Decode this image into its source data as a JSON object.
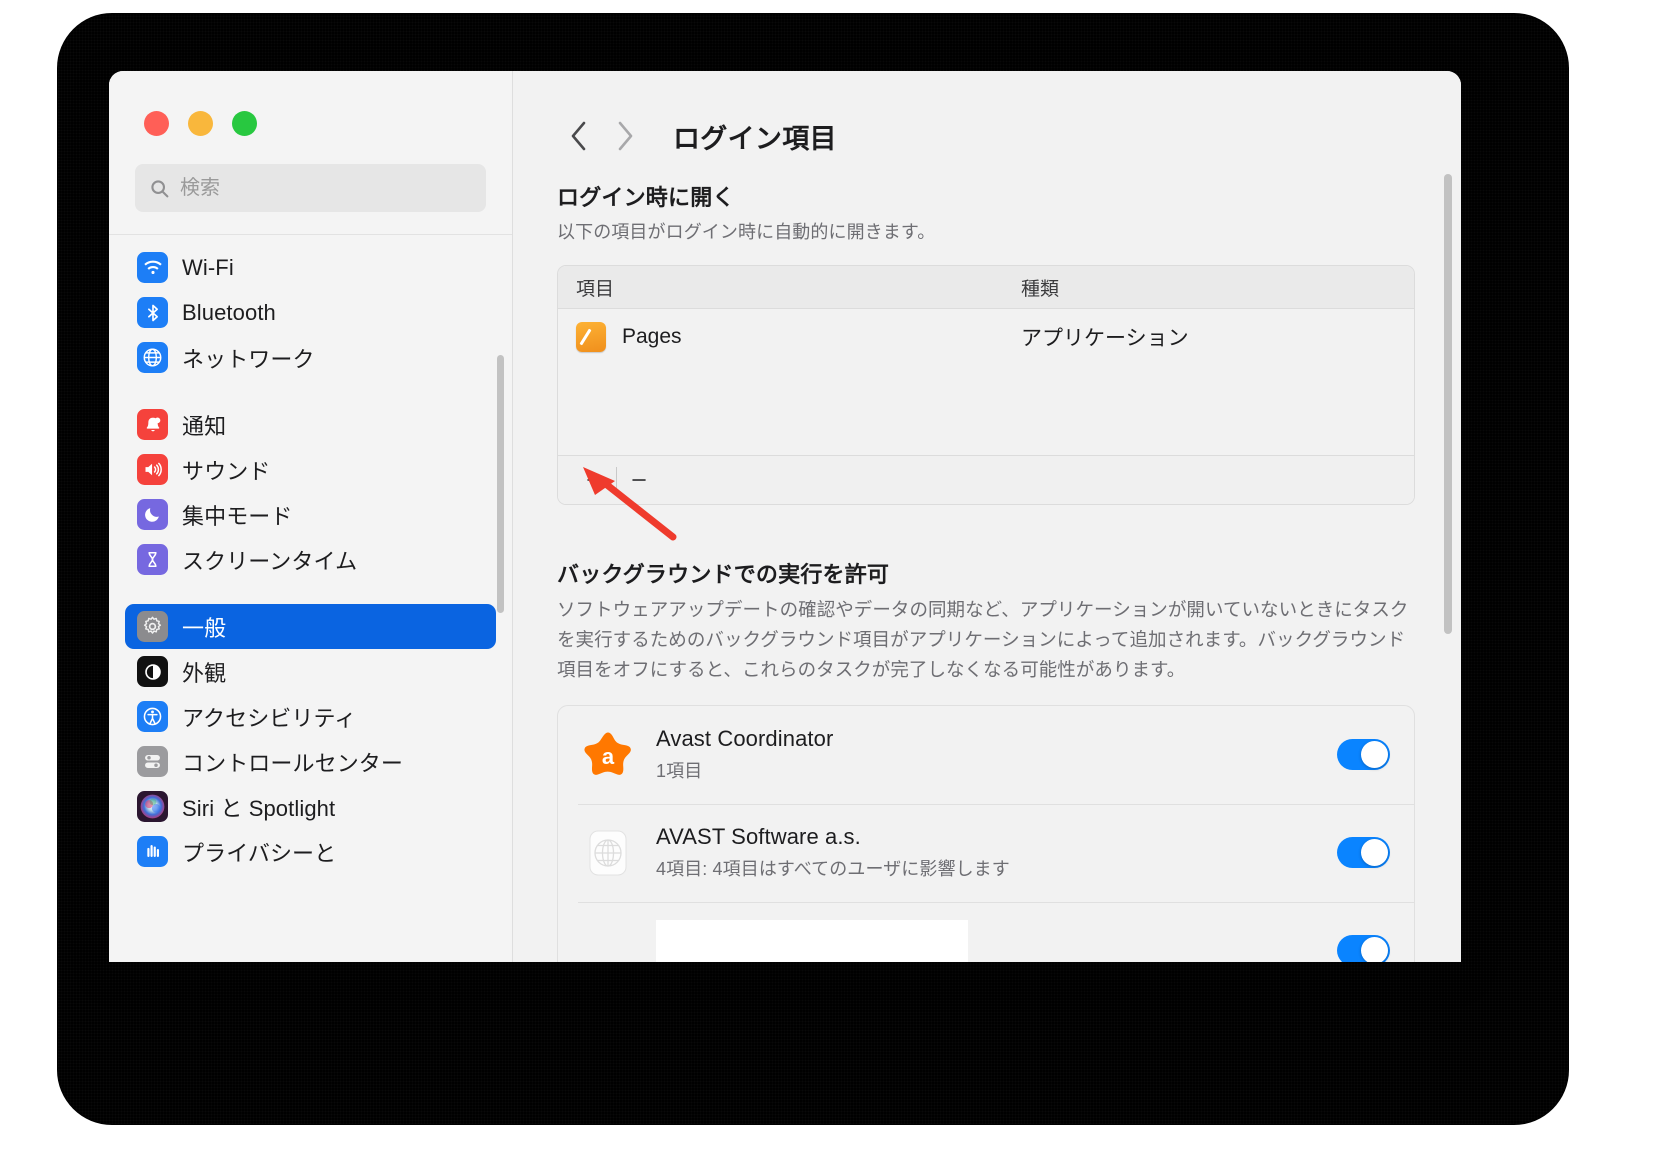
{
  "window": {
    "traffic_lights": [
      "close",
      "minimize",
      "zoom"
    ],
    "colors": {
      "close": "#ff5f57",
      "minimize": "#f9b73c",
      "zoom": "#28c840",
      "accent": "#0a64e1",
      "toggle_on": "#0a84ff",
      "annotation": "#ef3b2d"
    }
  },
  "sidebar": {
    "search": {
      "placeholder": "検索",
      "value": "",
      "icon": "search-icon"
    },
    "groups": [
      {
        "items": [
          {
            "label": "Wi-Fi",
            "icon": "wifi-icon",
            "selected": false
          },
          {
            "label": "Bluetooth",
            "icon": "bluetooth-icon",
            "selected": false
          },
          {
            "label": "ネットワーク",
            "icon": "network-globe-icon",
            "selected": false
          }
        ]
      },
      {
        "items": [
          {
            "label": "通知",
            "icon": "notifications-bell-icon",
            "selected": false
          },
          {
            "label": "サウンド",
            "icon": "sound-speaker-icon",
            "selected": false
          },
          {
            "label": "集中モード",
            "icon": "focus-moon-icon",
            "selected": false
          },
          {
            "label": "スクリーンタイム",
            "icon": "screen-time-hourglass-icon",
            "selected": false
          }
        ]
      },
      {
        "items": [
          {
            "label": "一般",
            "icon": "general-gear-icon",
            "selected": true
          },
          {
            "label": "外観",
            "icon": "appearance-contrast-icon",
            "selected": false
          },
          {
            "label": "アクセシビリティ",
            "icon": "accessibility-icon",
            "selected": false
          },
          {
            "label": "コントロールセンター",
            "icon": "control-center-icon",
            "selected": false
          },
          {
            "label": "Siri と Spotlight",
            "icon": "siri-icon",
            "selected": false
          },
          {
            "label": "プライバシーと",
            "icon": "privacy-hand-icon",
            "selected": false
          }
        ]
      }
    ]
  },
  "main": {
    "nav": {
      "back": "‹",
      "forward": "›"
    },
    "title": "ログイン項目",
    "login_items": {
      "heading": "ログイン時に開く",
      "subheading": "以下の項目がログイン時に自動的に開きます。",
      "columns": [
        "項目",
        "種類"
      ],
      "rows": [
        {
          "name": "Pages",
          "kind": "アプリケーション",
          "icon": "pages-app-icon"
        }
      ],
      "footer": {
        "add": "+",
        "remove": "−"
      }
    },
    "background": {
      "heading": "バックグラウンドでの実行を許可",
      "description": "ソフトウェアアップデートの確認やデータの同期など、アプリケーションが開いていないときにタスクを実行するためのバックグラウンド項目がアプリケーションによって追加されます。バックグラウンド項目をオフにすると、これらのタスクが完了しなくなる可能性があります。",
      "rows": [
        {
          "name": "Avast Coordinator",
          "sub": "1項目",
          "icon": "avast-logo-icon",
          "enabled": true,
          "redacted": false
        },
        {
          "name": "AVAST Software a.s.",
          "sub": "4項目: 4項目はすべてのユーザに影響します",
          "icon": "generic-bundle-icon",
          "enabled": true,
          "redacted": false
        },
        {
          "name": "",
          "sub": "",
          "icon": "redacted-icon",
          "enabled": true,
          "redacted": true
        }
      ]
    }
  },
  "annotation": {
    "type": "arrow",
    "points_to": "add-login-item-button",
    "color": "#ef3b2d"
  }
}
